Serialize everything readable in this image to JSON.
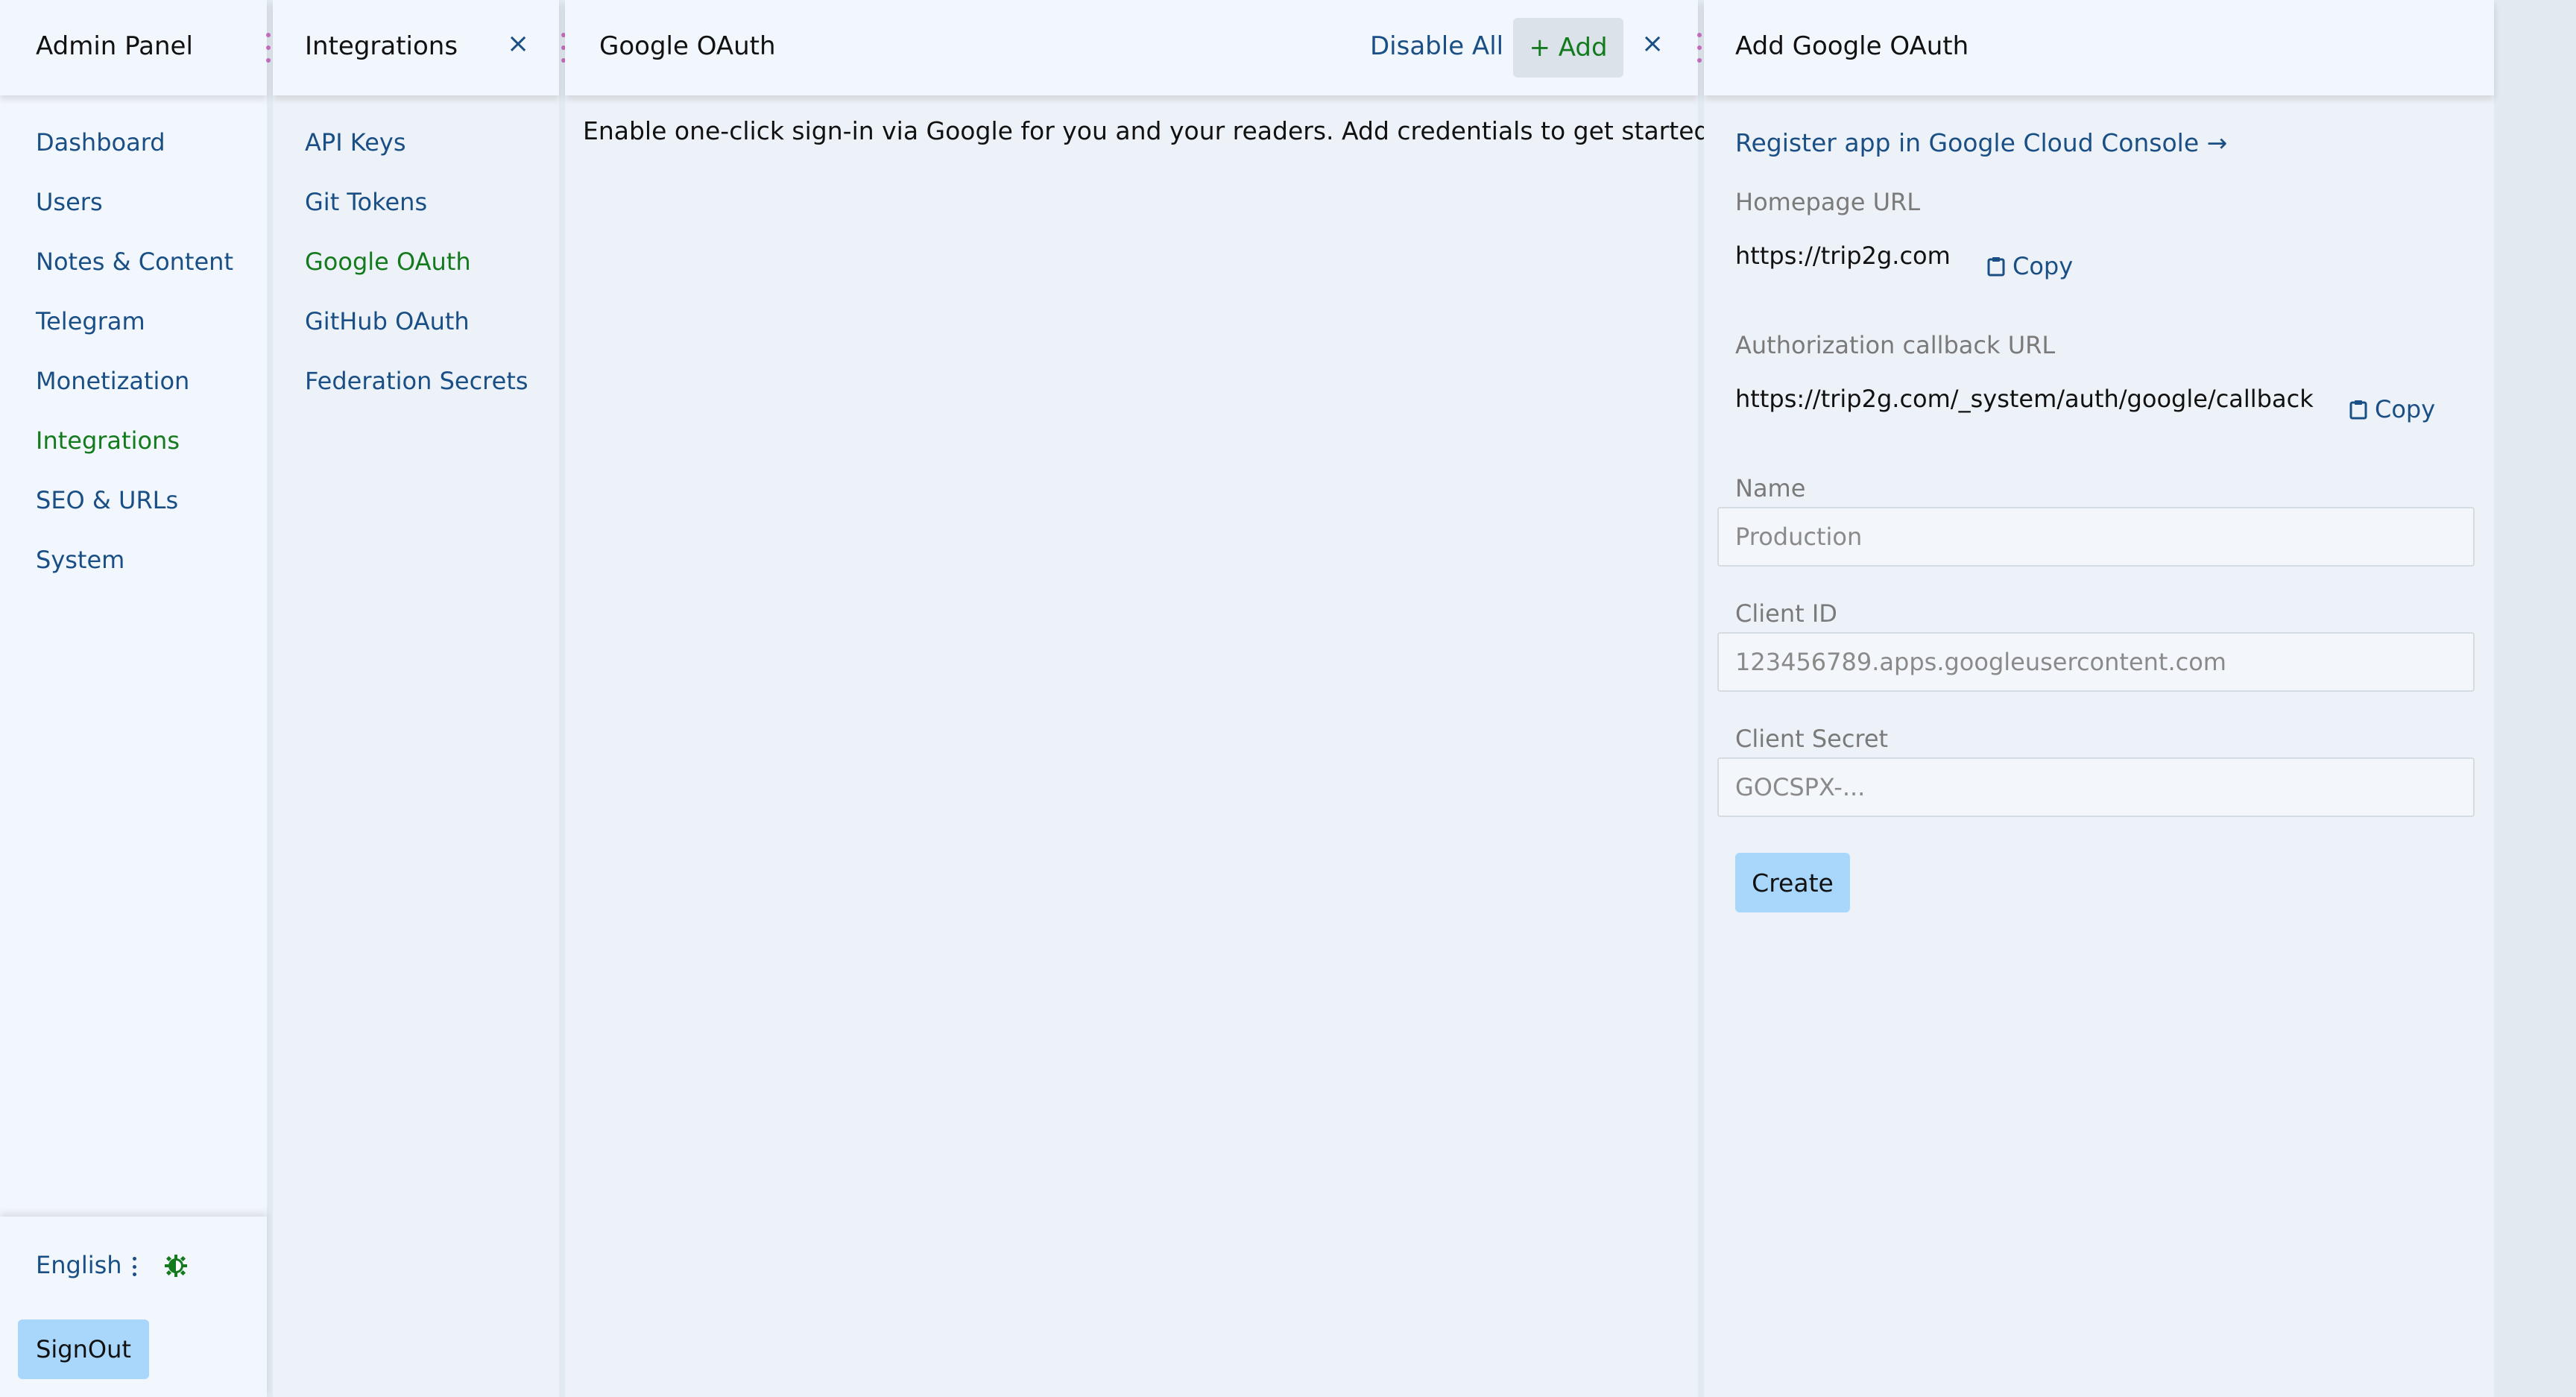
{
  "admin_panel": {
    "title": "Admin Panel",
    "nav": [
      "Dashboard",
      "Users",
      "Notes & Content",
      "Telegram",
      "Monetization",
      "Integrations",
      "SEO & URLs",
      "System"
    ],
    "active_index": 5,
    "language": "English",
    "signout_label": "SignOut"
  },
  "integrations_panel": {
    "title": "Integrations",
    "close_glyph": "×",
    "items": [
      "API Keys",
      "Git Tokens",
      "Google OAuth",
      "GitHub OAuth",
      "Federation Secrets"
    ],
    "active_index": 2
  },
  "google_oauth_panel": {
    "title": "Google OAuth",
    "disable_all_label": "Disable All",
    "add_label": "+ Add",
    "close_glyph": "×",
    "intro_text": "Enable one-click sign-in via Google for you and your readers. Add credentials to get started."
  },
  "add_panel": {
    "title": "Add Google OAuth",
    "register_link": "Register app in Google Cloud Console →",
    "homepage_label": "Homepage URL",
    "homepage_value": "https://trip2g.com",
    "callback_label": "Authorization callback URL",
    "callback_value": "https://trip2g.com/_system/auth/google/callback",
    "copy_label": "Copy",
    "name_label": "Name",
    "name_placeholder": "Production",
    "client_id_label": "Client ID",
    "client_id_placeholder": "123456789.apps.googleusercontent.com",
    "client_secret_label": "Client Secret",
    "client_secret_placeholder": "GOCSPX-...",
    "create_label": "Create"
  },
  "colors": {
    "link": "#1a4f86",
    "active": "#137a1d",
    "primary_button": "#a9d6fb",
    "grip": "#c46dc0"
  }
}
